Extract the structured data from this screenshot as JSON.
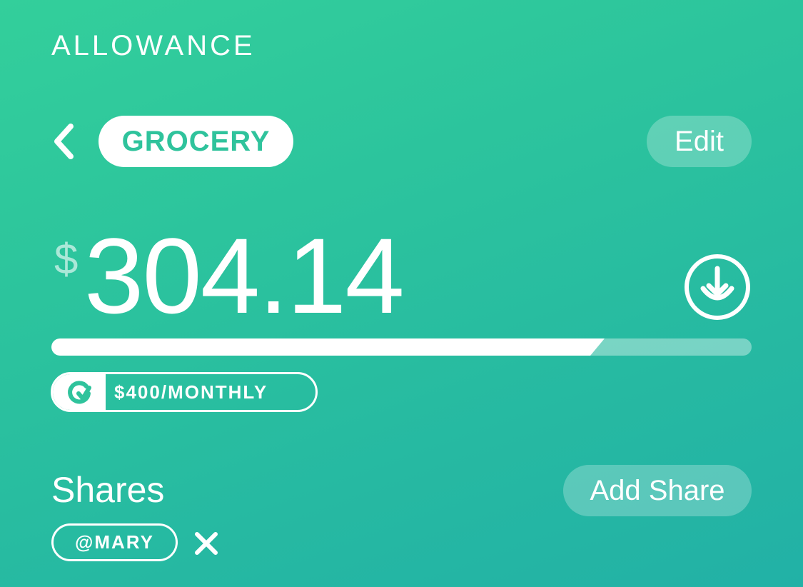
{
  "header": {
    "title": "ALLOWANCE"
  },
  "category": {
    "name": "GROCERY",
    "edit_label": "Edit",
    "back_icon": "chevron-left-icon"
  },
  "balance": {
    "currency_symbol": "$",
    "amount": "304.14",
    "withdraw_icon": "download-circle-icon"
  },
  "budget": {
    "spent_fraction": 0.79,
    "limit_label": "$400/MONTHLY",
    "recurring_icon": "refresh-icon"
  },
  "shares": {
    "heading": "Shares",
    "add_label": "Add Share",
    "items": [
      {
        "handle": "@MARY",
        "remove_icon": "close-icon"
      }
    ]
  },
  "colors": {
    "accent": "#2fc39c",
    "gradient_start": "#33cf9b",
    "gradient_end": "#22b1a6",
    "text": "#ffffff"
  }
}
